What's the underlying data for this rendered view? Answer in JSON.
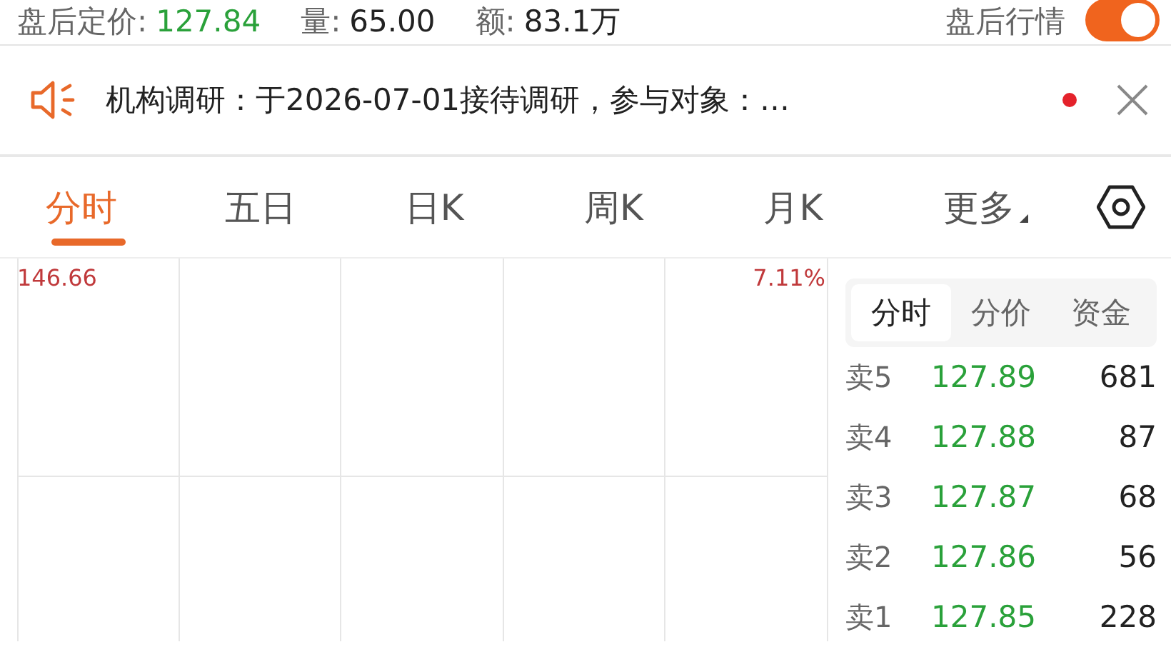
{
  "after_hours": {
    "price_label": "盘后定价:",
    "price": "127.84",
    "volume_label": "量:",
    "volume": "65.00",
    "amount_label": "额:",
    "amount": "83.1万",
    "toggle_label": "盘后行情",
    "toggle_on": true
  },
  "notice": {
    "text": "机构调研：于2026-07-01接待调研，参与对象：…",
    "unread": true
  },
  "tabs": [
    {
      "label": "分时",
      "selected": true,
      "kind": "tab"
    },
    {
      "label": "五日",
      "selected": false,
      "kind": "tab"
    },
    {
      "label": "日K",
      "selected": false,
      "kind": "tab"
    },
    {
      "label": "周K",
      "selected": false,
      "kind": "tab"
    },
    {
      "label": "月K",
      "selected": false,
      "kind": "tab"
    },
    {
      "label": "更多",
      "selected": false,
      "kind": "menu"
    }
  ],
  "chart": {
    "top_price": "146.66",
    "top_change": "7.11%"
  },
  "order_book": {
    "tabs": [
      {
        "label": "分时",
        "selected": true
      },
      {
        "label": "分价",
        "selected": false
      },
      {
        "label": "资金",
        "selected": false
      }
    ],
    "rows": [
      {
        "label": "卖5",
        "price": "127.89",
        "volume": "681"
      },
      {
        "label": "卖4",
        "price": "127.88",
        "volume": "87"
      },
      {
        "label": "卖3",
        "price": "127.87",
        "volume": "68"
      },
      {
        "label": "卖2",
        "price": "127.86",
        "volume": "56"
      },
      {
        "label": "卖1",
        "price": "127.85",
        "volume": "228"
      }
    ]
  }
}
